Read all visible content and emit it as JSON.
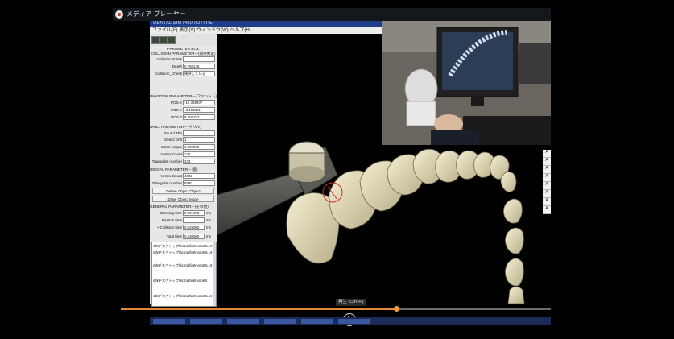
{
  "player": {
    "app_title": "メディア プレーヤー",
    "tooltip": "再生 (Ctrl+P)",
    "progress_fraction": 0.64
  },
  "app_window": {
    "title": "DENTAL SIM PROTOTYPE",
    "menu": "ファイル(F)  表示(V)  ウィンドウ(W)  ヘルプ(H)"
  },
  "panel": {
    "box_title": "PARAMETER BOX",
    "collision_header": "COLLISION PARAMETER---(衝突判定)",
    "collision_points_label": "Collision Points",
    "collision_points_value": "",
    "depth_label": "Depth",
    "depth_value": "0.768126",
    "collision_check_label": "Collision_Check",
    "collision_check_value": "衝突している",
    "phantom_header": "PHANTOM PARAMETER---(ファントム)",
    "pos_x_label": "POS.X",
    "pos_x_value": "-10.759937",
    "pos_y_label": "POS.Y",
    "pos_y_value": "-3.468801",
    "pos_z_label": "POS.Z",
    "pos_z_value": "8.408157",
    "drill_header": "DRILL PARAMETER---(ドリル)",
    "sound_label": "Sound The",
    "sound_value": "",
    "select_drill_label": "Select Drill",
    "select_drill_value": "1",
    "motor_label": "Motor torque",
    "motor_value": "1.000000",
    "drill_vertex_label": "Vertex Count",
    "drill_vertex_value": "170",
    "drill_tri_label": "Triangular number",
    "drill_tri_value": "333",
    "dental_header": "DENTAL PARAMETER---(歯)",
    "dental_vertex_label": "Vertex Count",
    "dental_vertex_value": "4892",
    "dental_tri_label": "Triangular number",
    "dental_tri_value": "9780",
    "delete_button": "Delete Object Object",
    "draw_button": "Draw Object Mode",
    "general_header": "GENERAL PARAMETER---(その他)",
    "drawing_label": "Drawing time",
    "drawing_value": "0.001000",
    "drawing_unit": "ms",
    "haptics_label": "Haptics time",
    "haptics_value": "",
    "haptics_unit": "ms",
    "collision_time_label": "+ Collision time",
    "collision_time_value": "0.029000",
    "collision_time_unit": "ms",
    "total_label": "Total time",
    "total_value": "0.030000",
    "total_unit": "ms"
  },
  "log": [
    "sd¥デスクトップ¥kozo¥fin¥moro¥6L1¥",
    "sd¥デスクトップ¥kozo¥fin¥moro¥6L1¥",
    "sd¥デスクトップ¥kozo¥fin¥moro¥6L1¥",
    "sd¥デスクトップ¥kozo¥fin¥moro¥6l",
    "sd¥デスクトップ¥kozo¥fin¥moro¥6L1¥"
  ],
  "side_toolbar": [
    "A",
    "A",
    "A",
    "A",
    "A",
    "A",
    "A",
    "A"
  ]
}
